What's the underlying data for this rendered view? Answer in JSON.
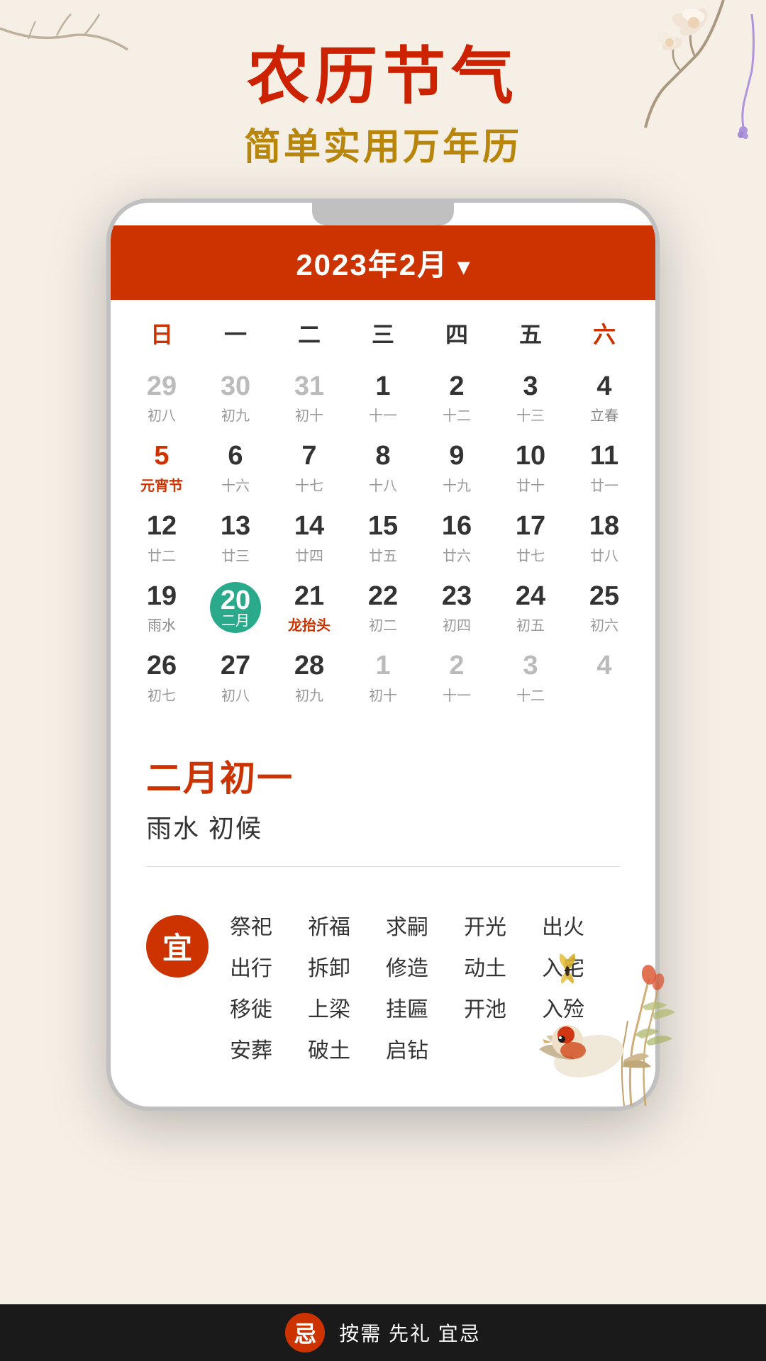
{
  "header": {
    "title_main": "农历节气",
    "title_sub": "简单实用万年历"
  },
  "calendar": {
    "month_label": "2023年2月",
    "dow_headers": [
      "日",
      "一",
      "二",
      "三",
      "四",
      "五",
      "六"
    ],
    "weeks": [
      [
        {
          "day": "29",
          "lunar": "初八",
          "dim": true
        },
        {
          "day": "30",
          "lunar": "初九",
          "dim": true
        },
        {
          "day": "31",
          "lunar": "初十",
          "dim": true
        },
        {
          "day": "1",
          "lunar": "十一",
          "dim": false
        },
        {
          "day": "2",
          "lunar": "十二",
          "dim": false
        },
        {
          "day": "3",
          "lunar": "十三",
          "dim": false
        },
        {
          "day": "4",
          "lunar": "立春",
          "dim": false,
          "solar_term": true
        }
      ],
      [
        {
          "day": "5",
          "lunar": "元宵节",
          "dim": false,
          "festival": true
        },
        {
          "day": "6",
          "lunar": "十六",
          "dim": false
        },
        {
          "day": "7",
          "lunar": "十七",
          "dim": false
        },
        {
          "day": "8",
          "lunar": "十八",
          "dim": false
        },
        {
          "day": "9",
          "lunar": "十九",
          "dim": false
        },
        {
          "day": "10",
          "lunar": "廿十",
          "dim": false
        },
        {
          "day": "11",
          "lunar": "廿一",
          "dim": false
        }
      ],
      [
        {
          "day": "12",
          "lunar": "廿二",
          "dim": false
        },
        {
          "day": "13",
          "lunar": "廿三",
          "dim": false
        },
        {
          "day": "14",
          "lunar": "廿四",
          "dim": false
        },
        {
          "day": "15",
          "lunar": "廿五",
          "dim": false
        },
        {
          "day": "16",
          "lunar": "廿六",
          "dim": false
        },
        {
          "day": "17",
          "lunar": "廿七",
          "dim": false
        },
        {
          "day": "18",
          "lunar": "廿八",
          "dim": false
        }
      ],
      [
        {
          "day": "19",
          "lunar": "雨水",
          "dim": false,
          "solar_term": true
        },
        {
          "day": "20",
          "lunar": "二月",
          "dim": false,
          "today": true
        },
        {
          "day": "21",
          "lunar": "龙抬头",
          "dim": false,
          "festival": true
        },
        {
          "day": "22",
          "lunar": "初二",
          "dim": false
        },
        {
          "day": "23",
          "lunar": "初四",
          "dim": false
        },
        {
          "day": "24",
          "lunar": "初五",
          "dim": false
        },
        {
          "day": "25",
          "lunar": "初六",
          "dim": false
        }
      ],
      [
        {
          "day": "26",
          "lunar": "初七",
          "dim": false
        },
        {
          "day": "27",
          "lunar": "初八",
          "dim": false
        },
        {
          "day": "28",
          "lunar": "初九",
          "dim": false
        },
        {
          "day": "1",
          "lunar": "初十",
          "dim": true
        },
        {
          "day": "2",
          "lunar": "十一",
          "dim": true
        },
        {
          "day": "3",
          "lunar": "十二",
          "dim": true
        },
        {
          "day": "4",
          "lunar": "",
          "dim": true
        }
      ]
    ]
  },
  "selected_date": {
    "label": "二月初一",
    "solar_term": "雨水 初候"
  },
  "auspicious": {
    "badge": "宜",
    "items": [
      "祭祀",
      "祈福",
      "求嗣",
      "开光",
      "出火",
      "出行",
      "拆卸",
      "修造",
      "动土",
      "入宅",
      "移徙",
      "上梁",
      "挂匾",
      "开池",
      "入殓",
      "安葬",
      "破土",
      "启钻",
      "",
      ""
    ]
  },
  "bottom": {
    "icon_label": "忌",
    "hint_text": "按需 先礼 宜忌"
  },
  "colors": {
    "primary_red": "#cc3300",
    "teal": "#2aaa8a",
    "gold": "#b8860b",
    "text_dim": "#bbb"
  }
}
